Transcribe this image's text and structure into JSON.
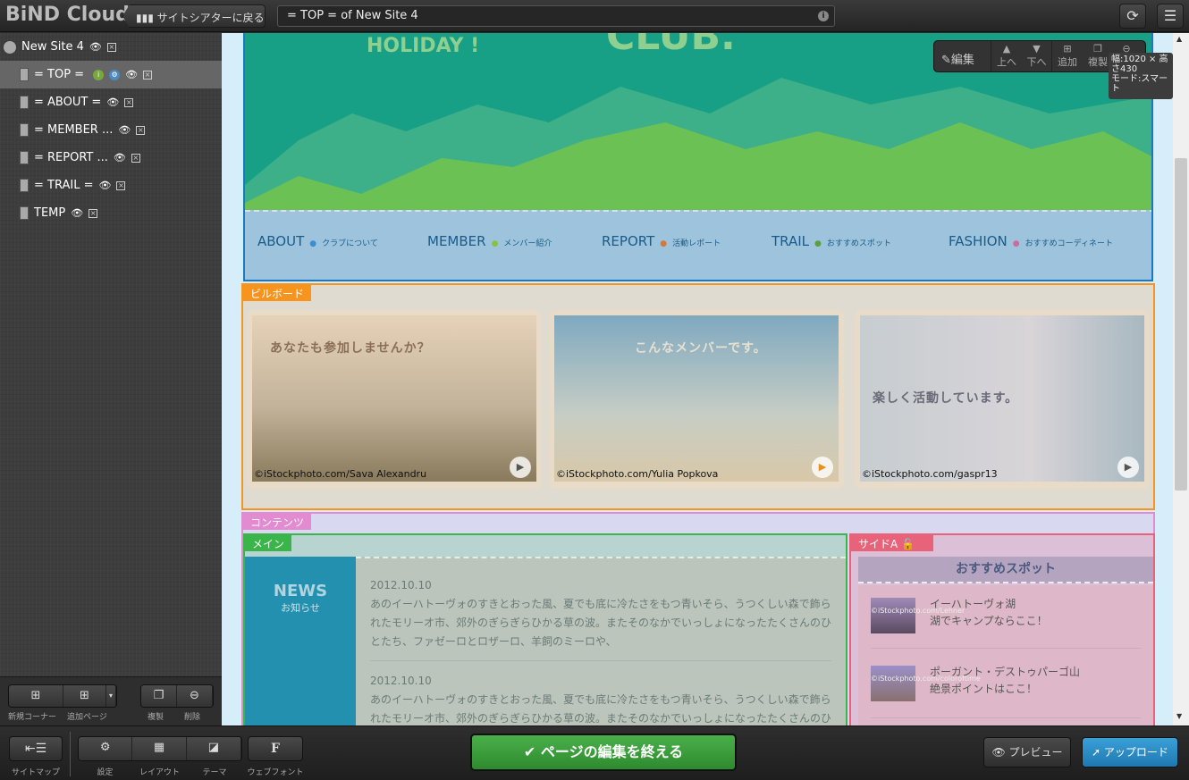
{
  "header": {
    "app_title": "BiND Cloud",
    "back_label": "サイトシアターに戻る",
    "page_title": "= TOP = of New Site 4",
    "info_icon": "i"
  },
  "sitemap": {
    "site": "New Site 4",
    "pages": [
      {
        "label": "= TOP ="
      },
      {
        "label": "= ABOUT ="
      },
      {
        "label": "= MEMBER ..."
      },
      {
        "label": "= REPORT ..."
      },
      {
        "label": "= TRAIL ="
      },
      {
        "label": "TEMP"
      }
    ]
  },
  "side_tools": {
    "new_corner": "新規コーナー",
    "add_page": "追加ページ",
    "duplicate": "複製",
    "delete": "削除"
  },
  "block_toolbar": {
    "edit": "編集",
    "up": "上へ",
    "down": "下へ",
    "add": "追加",
    "duplicate": "複製",
    "tooltip_size": "幅:1020 × 高さ430",
    "tooltip_mode": "モード:スマート"
  },
  "hero": {
    "text_left": "HOLIDAY !",
    "text_center": "CLUB."
  },
  "nav": [
    {
      "label": "ABOUT",
      "sub": "クラブについて",
      "color": "#3a8fd0"
    },
    {
      "label": "MEMBER",
      "sub": "メンバー紹介",
      "color": "#8ac04a"
    },
    {
      "label": "REPORT",
      "sub": "活動レポート",
      "color": "#d07a3a"
    },
    {
      "label": "TRAIL",
      "sub": "おすすめスポット",
      "color": "#5aa040"
    },
    {
      "label": "FASHION",
      "sub": "おすすめコーディネート",
      "color": "#d06a9a"
    }
  ],
  "areas": {
    "billboard": "ビルボード",
    "contents": "コンテンツ",
    "main": "メイン",
    "side_a": "サイドA"
  },
  "billboard": [
    {
      "caption": "あなたも参加しませんか？",
      "credit": "©iStockphoto.com/Sava Alexandru"
    },
    {
      "caption": "こんなメンバーです。",
      "credit": "©iStockphoto.com/Yulia Popkova"
    },
    {
      "caption": "楽しく活動しています。",
      "credit": "©iStockphoto.com/gaspr13"
    }
  ],
  "news": {
    "title": "NEWS",
    "subtitle": "お知らせ",
    "items": [
      {
        "date": "2012.10.10",
        "text": "あのイーハトーヴォのすきとおった風、夏でも底に冷たさをもつ青いそら、うつくしい森で飾られたモリーオ市、郊外のぎらぎらひかる草の波。またそのなかでいっしょになったたくさんのひとたち、ファゼーロとロザーロ、羊飼のミーロや、"
      },
      {
        "date": "2012.10.10",
        "text": "あのイーハトーヴォのすきとおった風、夏でも底に冷たさをもつ青いそら、うつくしい森で飾られたモリーオ市、郊外のぎらぎらひかる草の波。またそのなかでいっしょになったたくさんのひとたち、ファゼーロとロザーロ、羊飼のミーロや、"
      }
    ]
  },
  "spots": {
    "title": "おすすめスポット",
    "items": [
      {
        "name": "イーハトーヴォ湖",
        "desc": "湖でキャンプならここ！",
        "thumb_credit": "©iStockphoto.com/Lehner"
      },
      {
        "name": "ポーガント・デストゥパーゴ山",
        "desc": "絶景ポイントはここ！",
        "thumb_credit": "©iStockphoto.com/coloroftime"
      }
    ]
  },
  "bottom": {
    "sitemap": "サイトマップ",
    "settings": "設定",
    "layout": "レイアウト",
    "theme": "テーマ",
    "webfont": "ウェブフォント",
    "finish": "ページの編集を終える",
    "preview": "プレビュー",
    "upload": "アップロード"
  },
  "colors": {
    "billboard": "#f7941d",
    "contents": "#e38bd0",
    "main": "#3ab54a",
    "side_a": "#e8637a",
    "upload": "#2a8fc8",
    "finish": "#3a9a3a"
  }
}
